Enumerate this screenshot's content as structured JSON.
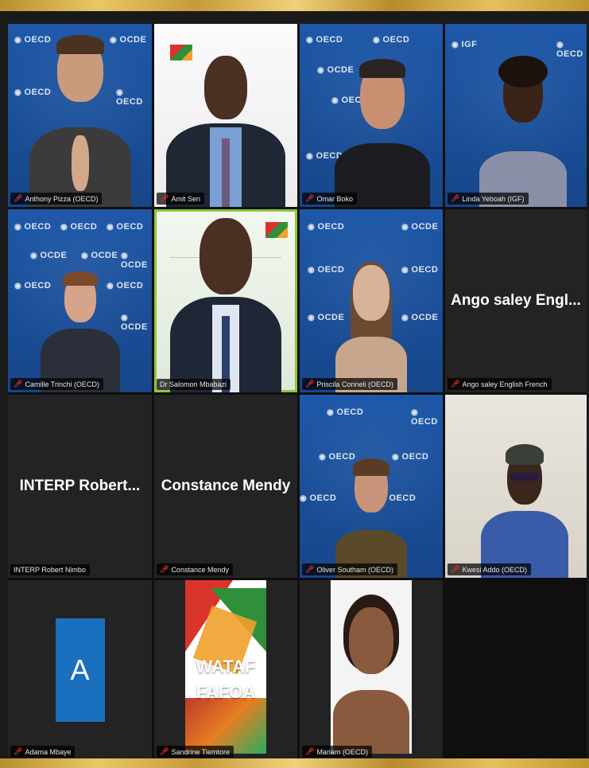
{
  "meeting": {
    "title": "",
    "colors": {
      "frame_gold": "#d4af52",
      "background": "#1a1a1a",
      "tile_dark": "#232323",
      "oecd_blue": "#1e58a8",
      "active_speaker": "#8cc63f",
      "muted_mic": "#e0302a"
    }
  },
  "participants": [
    {
      "id": "p1",
      "name": "Anthony Pizza (OECD)",
      "type": "video",
      "background": "oecd",
      "muted": true
    },
    {
      "id": "p2",
      "name": "Amit Sen",
      "type": "video",
      "background": "white",
      "muted": true
    },
    {
      "id": "p3",
      "name": "Omar Boko",
      "type": "video",
      "background": "oecd",
      "muted": true
    },
    {
      "id": "p4",
      "name": "Linda Yeboah (IGF)",
      "type": "video",
      "background": "oecd",
      "muted": true
    },
    {
      "id": "p5",
      "name": "Camille Trinchi (OECD)",
      "type": "video",
      "background": "oecd",
      "muted": true
    },
    {
      "id": "p6",
      "name": "Dr Salomon Mbabazi",
      "type": "video",
      "background": "mint",
      "muted": false,
      "active_speaker": true
    },
    {
      "id": "p7",
      "name": "Priscila Conneli (OECD)",
      "type": "video",
      "background": "oecd",
      "muted": true
    },
    {
      "id": "p8",
      "name": "Ango saley English French",
      "display_name": "Ango saley Engl...",
      "type": "name_only",
      "muted": true
    },
    {
      "id": "p9",
      "name": "INTERP Robert Nimbo",
      "display_name": "INTERP  Robert...",
      "type": "name_only",
      "muted": false
    },
    {
      "id": "p10",
      "name": "Constance Mendy",
      "display_name": "Constance Mendy",
      "type": "name_only",
      "muted": true
    },
    {
      "id": "p11",
      "name": "Oliver Southam (OECD)",
      "type": "video",
      "background": "oecd",
      "muted": true
    },
    {
      "id": "p12",
      "name": "Kwesi Addo (OECD)",
      "type": "video",
      "background": "beige",
      "muted": true
    },
    {
      "id": "p13",
      "name": "Adama Mbaye",
      "type": "avatar",
      "avatar_letter": "A",
      "muted": true
    },
    {
      "id": "p14",
      "name": "Sandrine Tiemtore",
      "type": "logo",
      "logo_lines": [
        "WATAF",
        "FAFOA"
      ],
      "muted": true
    },
    {
      "id": "p15",
      "name": "Mariam (OECD)",
      "type": "photo",
      "muted": true
    }
  ],
  "icons": {
    "muted": "mic-muted-icon",
    "oecd_watermark": "oecd-logo-icon",
    "igf_watermark": "igf-logo-icon"
  },
  "watermark_text": {
    "oecd": "OECD",
    "ocde": "OCDE",
    "igf": "IGF"
  }
}
